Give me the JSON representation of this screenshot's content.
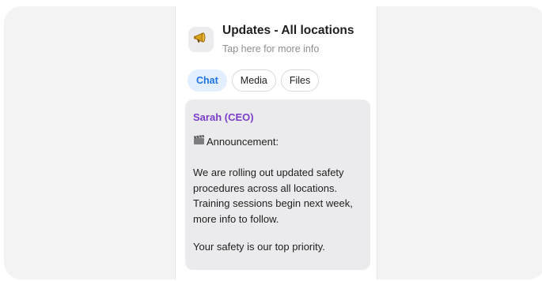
{
  "channel": {
    "icon": "megaphone-icon",
    "title": "Updates - All locations",
    "subtitle": "Tap here for more info"
  },
  "tabs": [
    {
      "label": "Chat",
      "active": true
    },
    {
      "label": "Media",
      "active": false
    },
    {
      "label": "Files",
      "active": false
    }
  ],
  "message": {
    "sender": "Sarah (CEO)",
    "sender_color": "#7b3ec9",
    "announcement_icon": "film-clapper-icon",
    "announcement_label": "Announcement:",
    "body": "We are rolling out updated safety procedures across all locations. Training sessions begin next week, more info to follow.",
    "closing": "Your safety is our top priority."
  },
  "colors": {
    "accent": "#1f73e8",
    "active_tab_bg": "#e3efff",
    "bubble_bg": "#ebebed",
    "frame_bg": "#f3f3f4"
  }
}
